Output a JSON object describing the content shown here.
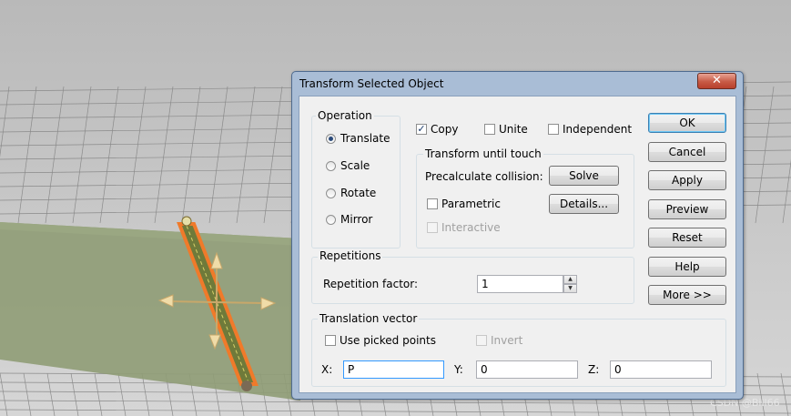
{
  "dialog": {
    "title": "Transform Selected Object",
    "close_icon": "close-icon",
    "operation": {
      "label": "Operation",
      "options": [
        "Translate",
        "Scale",
        "Rotate",
        "Mirror"
      ],
      "selected": "Translate"
    },
    "copy": {
      "label": "Copy",
      "checked": true
    },
    "unite": {
      "label": "Unite",
      "checked": false
    },
    "independent": {
      "label": "Independent",
      "checked": false
    },
    "touch": {
      "label": "Transform until touch",
      "precalc_label": "Precalculate collision:",
      "solve_label": "Solve",
      "parametric_label": "Parametric",
      "details_label": "Details...",
      "interactive_label": "Interactive"
    },
    "repetitions": {
      "label": "Repetitions",
      "factor_label": "Repetition factor:",
      "factor_value": "1"
    },
    "translation": {
      "label": "Translation vector",
      "use_picked_label": "Use picked points",
      "invert_label": "Invert",
      "x_label": "X:",
      "x_value": "P",
      "y_label": "Y:",
      "y_value": "0",
      "z_label": "Z:",
      "z_value": "0"
    },
    "buttons": {
      "ok": "OK",
      "cancel": "Cancel",
      "apply": "Apply",
      "preview": "Preview",
      "reset": "Reset",
      "help": "Help",
      "more": "More >>"
    }
  },
  "watermark": "CSDN @Bill66",
  "colors": {
    "object_outline": "#f07a2a",
    "object_fill": "#6f7a3a",
    "plane": "#8f9c75",
    "dialog_frame": "#a9bdd6"
  }
}
